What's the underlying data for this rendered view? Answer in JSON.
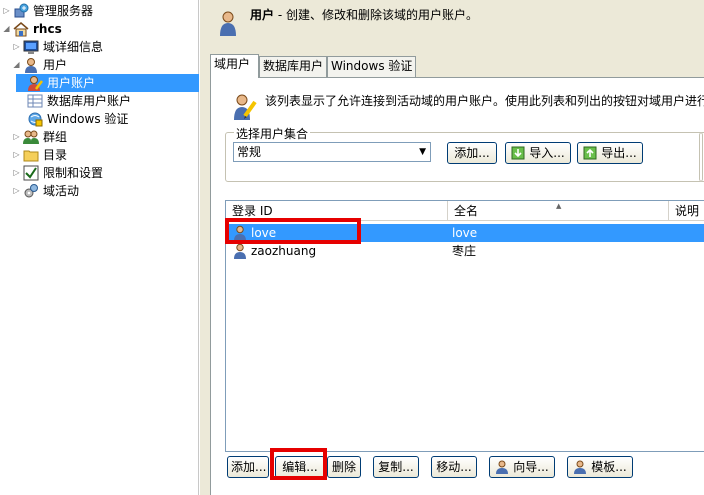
{
  "tree": {
    "items": [
      {
        "label": "管理服务器"
      },
      {
        "label": "rhcs"
      },
      {
        "label": "域详细信息"
      },
      {
        "label": "用户"
      },
      {
        "label": "用户账户"
      },
      {
        "label": "数据库用户账户"
      },
      {
        "label": "Windows 验证"
      },
      {
        "label": "群组"
      },
      {
        "label": "目录"
      },
      {
        "label": "限制和设置"
      },
      {
        "label": "域活动"
      }
    ]
  },
  "header": {
    "title": "用户",
    "subtitle": " - 创建、修改和删除该域的用户账户。"
  },
  "tabs": [
    {
      "label": "域用户"
    },
    {
      "label": "数据库用户"
    },
    {
      "label": "Windows 验证"
    }
  ],
  "description": "该列表显示了允许连接到活动域的用户账户。使用此列表和列出的按钮对域用户进行",
  "user_set": {
    "group_label": "选择用户集合",
    "selected": "常规",
    "add_label": "添加...",
    "import_label": "导入...",
    "export_label": "导出..."
  },
  "list": {
    "columns": [
      {
        "label": "登录 ID"
      },
      {
        "label": "全名"
      },
      {
        "label": "说明"
      }
    ],
    "rows": [
      {
        "login": "love",
        "fullname": "love",
        "note": ""
      },
      {
        "login": "zaozhuang",
        "fullname": "枣庄",
        "note": ""
      }
    ]
  },
  "actions": {
    "add": "添加...",
    "edit": "编辑...",
    "delete": "删除",
    "copy": "复制...",
    "move": "移动...",
    "wizard": "向导...",
    "template": "模板..."
  },
  "colors": {
    "selection": "#3399ff",
    "highlight_box": "#e60000",
    "panel_bg": "#ece9d8"
  }
}
